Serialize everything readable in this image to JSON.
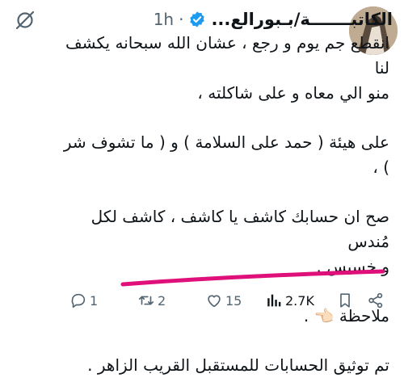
{
  "header": {
    "author_name": "الكاتبـــــــة/بـبورالع...",
    "separator": "·",
    "time": "1h"
  },
  "tweet": {
    "paragraphs": [
      [
        "انقطع جم يوم و رجع ، عشان الله سبحانه يكشف لنا",
        "منو الي معاه و على شاكلته ،"
      ],
      [
        "على هيئة ( حمد على السلامة ) و ( ما تشوف شر ) ،"
      ],
      [
        "صح ان حسابك كاشف يا كاشف ، كاشف لكل مُندس",
        "و خسيس ."
      ],
      [
        "ملاحظة 👈🏻 ."
      ],
      [
        "تم توثيق الحسابات للمستقبل القريب الزاهر ."
      ]
    ]
  },
  "actions": {
    "replies": "1",
    "reposts": "2",
    "likes": "15",
    "views": "2.7K"
  },
  "colors": {
    "highlight": "#e0107a",
    "verified": "#1d9bf0",
    "muted": "#536471"
  }
}
